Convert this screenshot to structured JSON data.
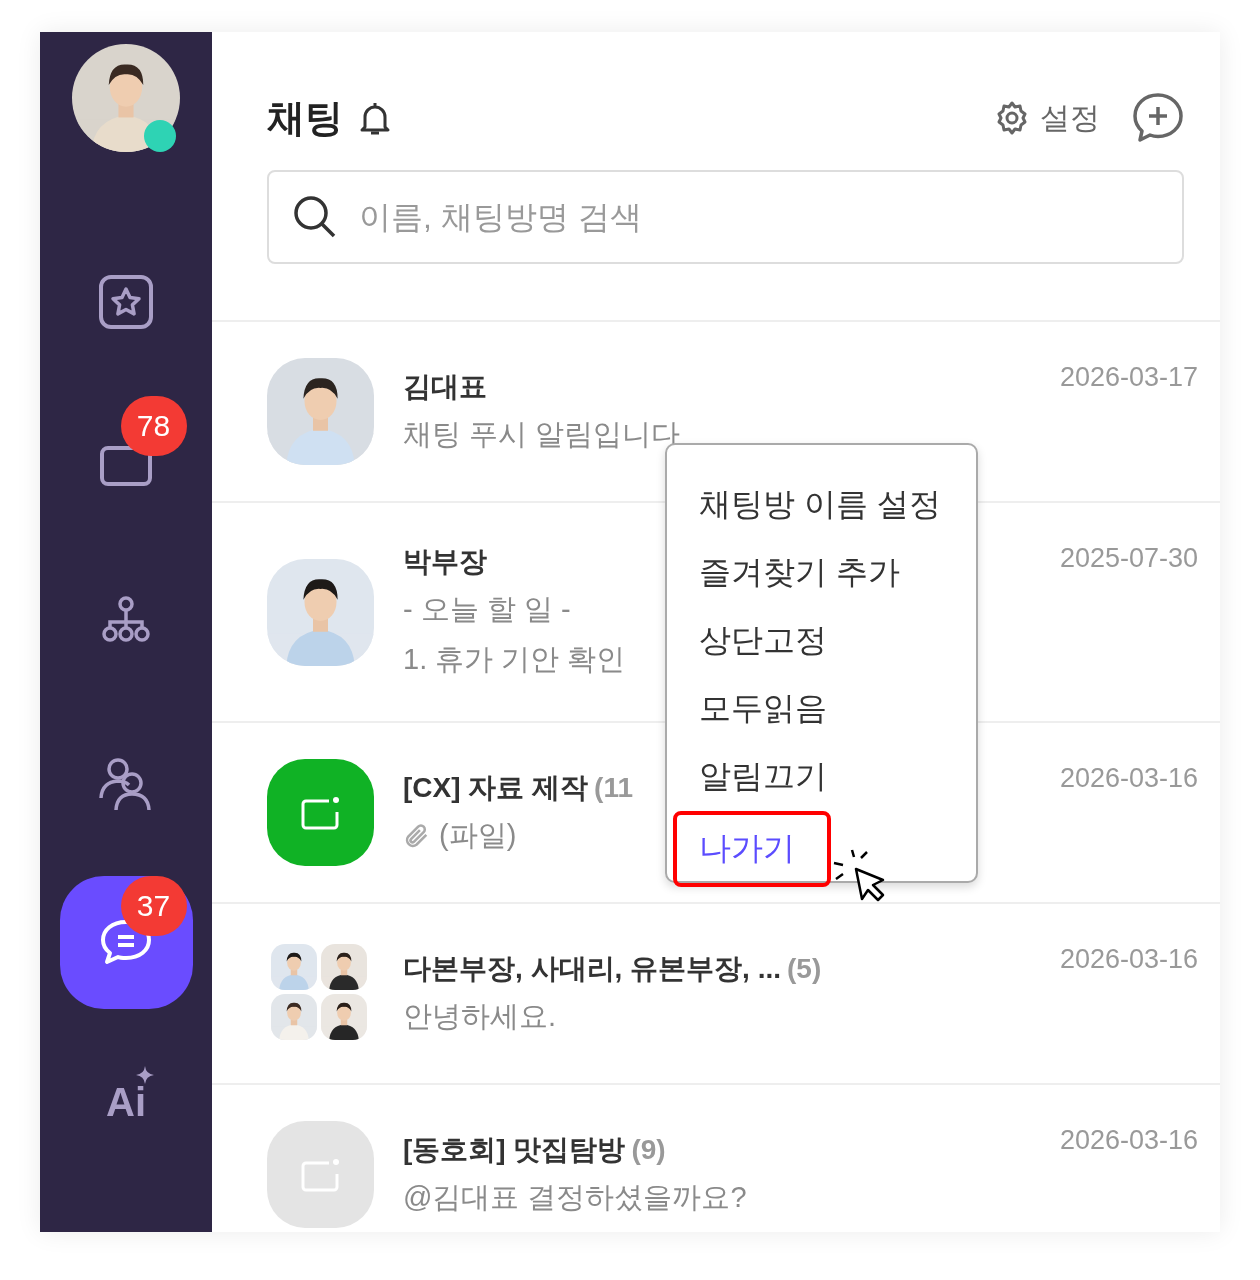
{
  "sidebar": {
    "profile": {
      "online": true
    },
    "items": [
      {
        "kind": "favorites",
        "selected": false
      },
      {
        "kind": "rooms",
        "badge": "78",
        "selected": false
      },
      {
        "kind": "organization",
        "selected": false
      },
      {
        "kind": "contacts",
        "selected": false
      },
      {
        "kind": "chat",
        "badge": "37",
        "selected": true
      },
      {
        "kind": "ai",
        "label": "Ai",
        "selected": false
      }
    ]
  },
  "header": {
    "title": "채팅",
    "settings_label": "설정"
  },
  "search": {
    "placeholder": "이름, 채팅방명 검색"
  },
  "chats": [
    {
      "name": "김대표",
      "preview": [
        "채팅 푸시 알림입니다"
      ],
      "date": "2026-03-17"
    },
    {
      "name": "박부장",
      "preview": [
        "- 오늘 할 일 -",
        "1. 휴가 기안 확인"
      ],
      "date": "2025-07-30"
    },
    {
      "kind": "room",
      "color": "#10b225",
      "name": "[CX] 자료 제작",
      "count": "(11",
      "attachment": true,
      "preview": [
        "(파일)"
      ],
      "date": "2026-03-16"
    },
    {
      "kind": "group",
      "name": "다본부장, 사대리, 유본부장, ...",
      "count": "(5)",
      "preview": [
        "안녕하세요."
      ],
      "date": "2026-03-16"
    },
    {
      "kind": "room",
      "color": "#e4e4e4",
      "name": "[동호회] 맛집탐방",
      "count": "(9)",
      "preview": [
        "@김대표 결정하셨을까요?"
      ],
      "date": "2026-03-16"
    }
  ],
  "context_menu": {
    "items": [
      {
        "label": "채팅방 이름 설정",
        "selected": false
      },
      {
        "label": "즐겨찾기 추가",
        "selected": false
      },
      {
        "label": "상단고정",
        "selected": false
      },
      {
        "label": "모두읽음",
        "selected": false
      },
      {
        "label": "알림끄기",
        "selected": false
      },
      {
        "label": "나가기",
        "selected": true
      }
    ]
  }
}
